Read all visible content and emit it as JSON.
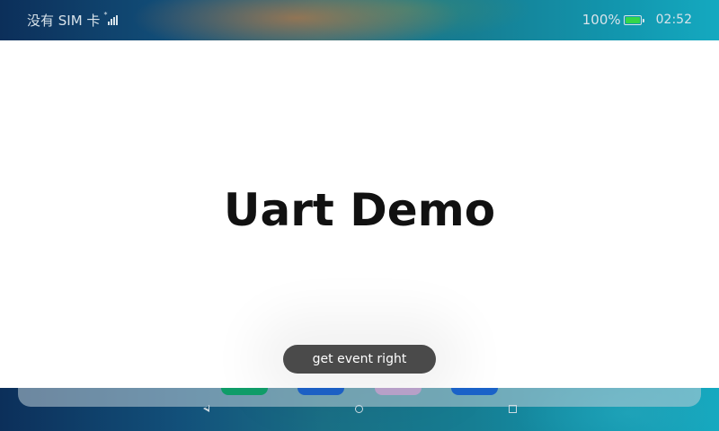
{
  "status_bar": {
    "carrier": "没有 SIM 卡",
    "signal_icon": "signal-no-sim-icon",
    "battery_percent": "100%",
    "battery_level": 1.0,
    "battery_icon": "battery-icon",
    "time": "02:52"
  },
  "app": {
    "title": "Uart Demo"
  },
  "toast": {
    "message": "get event right"
  },
  "dock": {
    "app_colors": [
      "#0f9c68",
      "#1c5fc4",
      "#b7a0c8",
      "#1a62c8"
    ]
  },
  "nav_bar": {
    "back_icon": "triangle-back-icon",
    "home_icon": "circle-home-icon",
    "recents_icon": "square-recents-icon"
  },
  "colors": {
    "battery_fill": "#34d64a",
    "toast_bg": "#4a4a4a",
    "title_text": "#111111"
  }
}
